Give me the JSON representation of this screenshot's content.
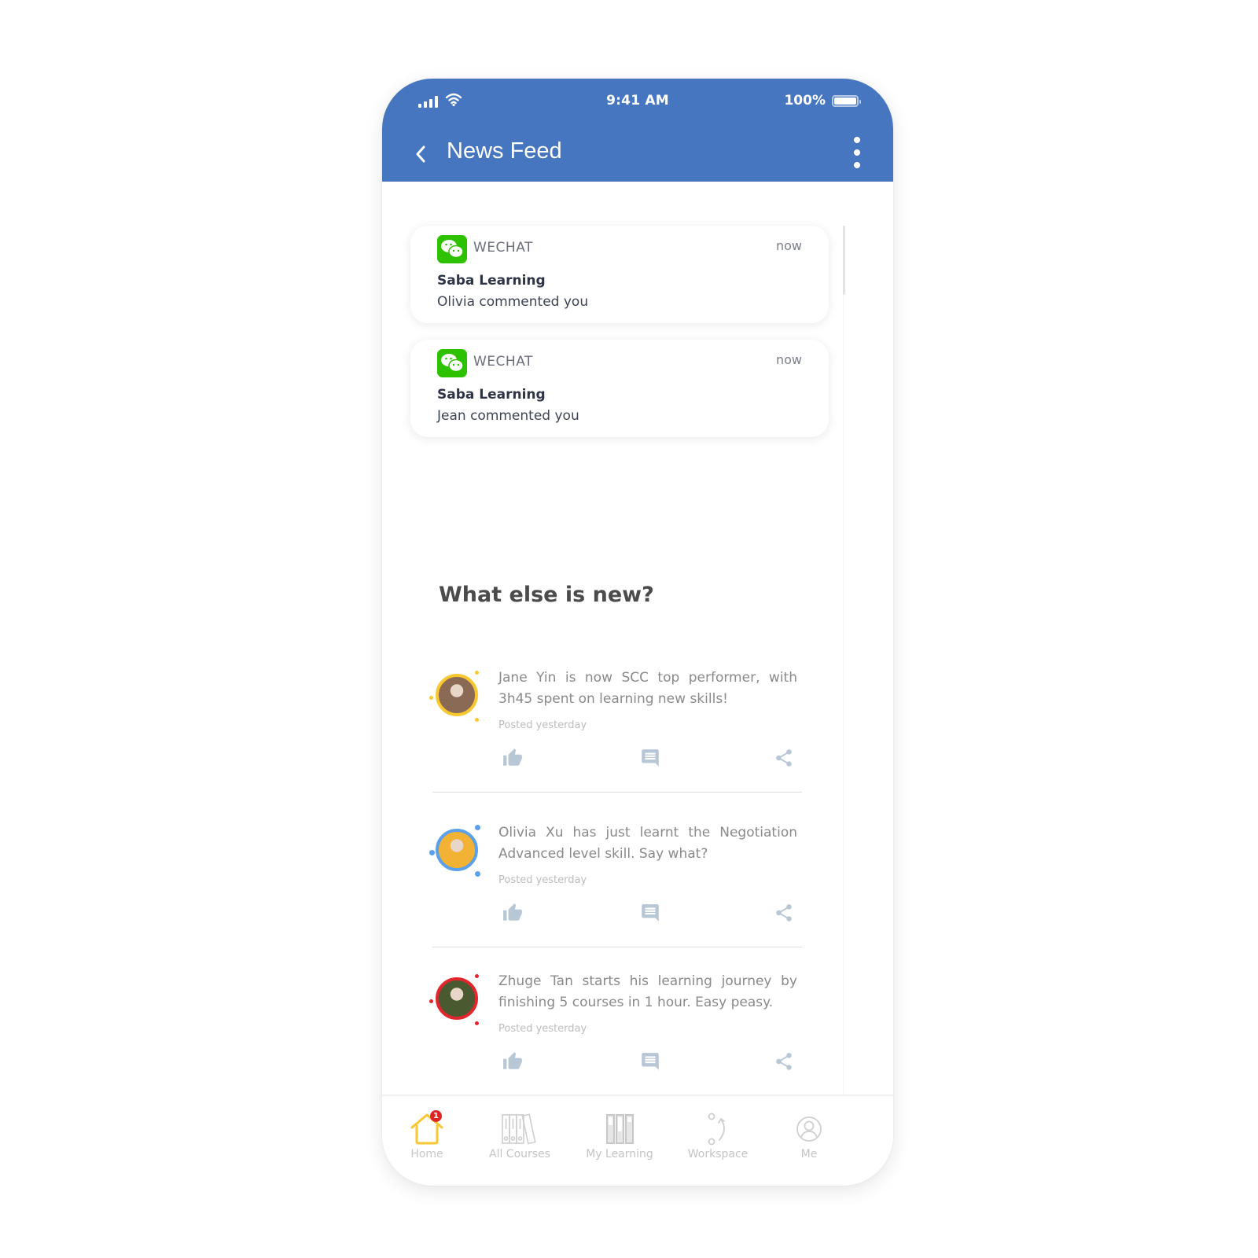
{
  "status_bar": {
    "time": "9:41 AM",
    "battery_percent": "100%",
    "signal_icon": "signal-bars-icon",
    "wifi_icon": "wifi-icon",
    "battery_icon": "battery-icon"
  },
  "header": {
    "title": "News Feed",
    "back_icon": "chevron-left-icon",
    "menu_icon": "more-vertical-icon",
    "color": "#4676bf"
  },
  "notifications": [
    {
      "app": "WECHAT",
      "time": "now",
      "sender": "Saba Learning",
      "message": "Olivia commented you",
      "icon": "wechat-icon"
    },
    {
      "app": "WECHAT",
      "time": "now",
      "sender": "Saba Learning",
      "message": "Jean commented you",
      "icon": "wechat-icon"
    }
  ],
  "feed": {
    "title": "What else is new?",
    "posts": [
      {
        "text": "Jane Yin is now SCC top performer, with 3h45 spent on learning new skills!",
        "posted": "Posted yesterday",
        "ring_color": "#f9c730",
        "avatar_bg": "#8a6a55"
      },
      {
        "text": "Olivia Xu has just learnt the Negotiation Advanced level skill. Say what?",
        "posted": "Posted yesterday",
        "ring_color": "#5aa0ea",
        "avatar_bg": "#f2b233"
      },
      {
        "text": "Zhuge Tan starts his learning journey by finishing 5 courses in 1 hour. Easy peasy.",
        "posted": "Posted yesterday",
        "ring_color": "#e3262e",
        "avatar_bg": "#4a5a30"
      }
    ],
    "actions": [
      "like-icon",
      "comment-icon",
      "share-icon"
    ]
  },
  "tabbar": {
    "items": [
      {
        "label": "Home",
        "icon": "home-icon",
        "active": true,
        "badge": "1"
      },
      {
        "label": "All Courses",
        "icon": "books-icon"
      },
      {
        "label": "My Learning",
        "icon": "binders-icon"
      },
      {
        "label": "Workspace",
        "icon": "workspace-icon"
      },
      {
        "label": "Me",
        "icon": "profile-icon"
      }
    ],
    "active_color": "#f9c730"
  }
}
